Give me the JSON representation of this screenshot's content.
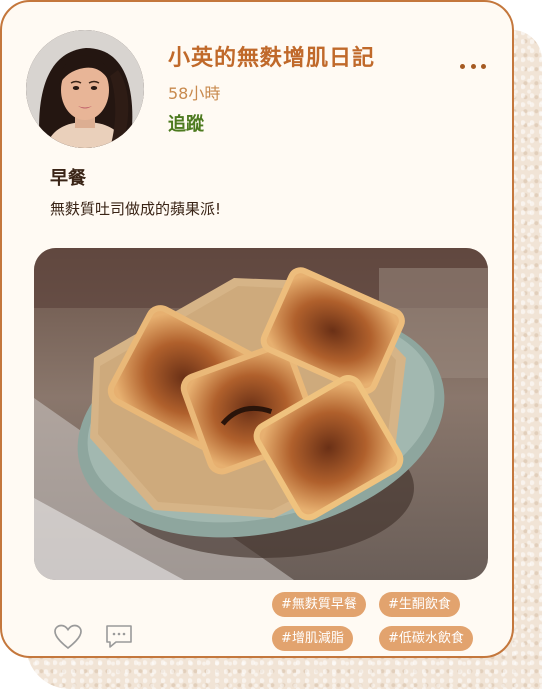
{
  "post": {
    "author": "小英的無麩增肌日記",
    "time": "58小時",
    "follow_label": "追蹤",
    "title": "早餐",
    "body": "無麩質吐司做成的蘋果派!",
    "tags": [
      "#無麩質早餐",
      "#生酮飲食",
      "#增肌減脂",
      "#低碳水飲食"
    ]
  },
  "colors": {
    "accent": "#c0692a",
    "border": "#c4773c",
    "follow": "#4d7a1f",
    "tag_bg": "#e2a36e",
    "card_bg": "#fffaf3"
  },
  "icons": {
    "more": "more-dots-icon",
    "like": "heart-icon",
    "comment": "comment-icon"
  }
}
